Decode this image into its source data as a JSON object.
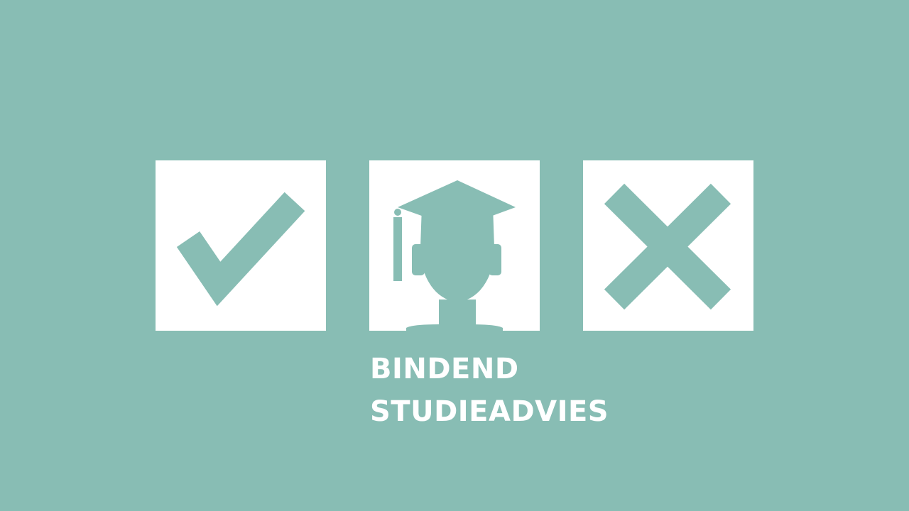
{
  "title": {
    "line1": "BINDEND",
    "line2": "STUDIEADVIES"
  },
  "icons": {
    "left": "checkmark-icon",
    "center": "graduate-student-icon",
    "right": "cross-icon"
  },
  "colors": {
    "background": "#88bdb4",
    "tile": "#ffffff",
    "text": "#ffffff"
  }
}
